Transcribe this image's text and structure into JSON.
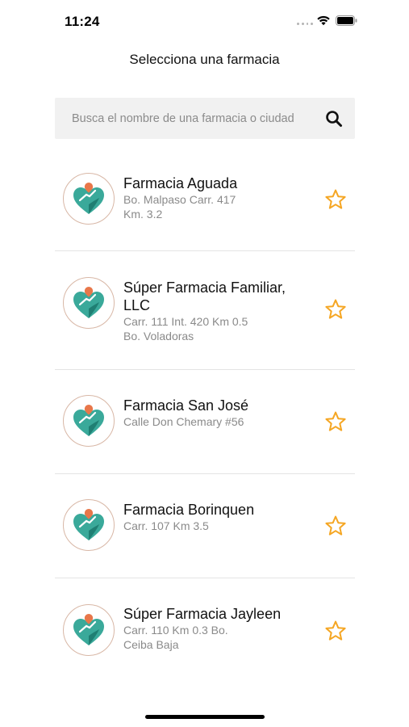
{
  "status_bar": {
    "time": "11:24"
  },
  "header": {
    "title": "Selecciona una farmacia"
  },
  "search": {
    "placeholder": "Busca el nombre de una farmacia o ciudad",
    "value": ""
  },
  "icons": {
    "search": "search-icon",
    "favorite": "star-outline-icon",
    "logo": "heart-hand-pin-logo"
  },
  "colors": {
    "star": "#f5a623",
    "logo_teal": "#3aa99a",
    "logo_pin": "#e8774a",
    "search_bg": "#f1f1f1"
  },
  "pharmacies": [
    {
      "name": "Farmacia Aguada",
      "address": "Bo. Malpaso Carr. 417\nKm. 3.2",
      "favorite": false
    },
    {
      "name": "Súper Farmacia Familiar,\nLLC",
      "address": "Carr. 111 Int. 420 Km 0.5\nBo. Voladoras",
      "favorite": false
    },
    {
      "name": "Farmacia San José",
      "address": "Calle Don Chemary #56",
      "favorite": false
    },
    {
      "name": "Farmacia Borinquen",
      "address": "Carr. 107 Km 3.5",
      "favorite": false
    },
    {
      "name": "Súper Farmacia Jayleen",
      "address": "Carr. 110 Km 0.3 Bo.\nCeiba Baja",
      "favorite": false
    }
  ]
}
